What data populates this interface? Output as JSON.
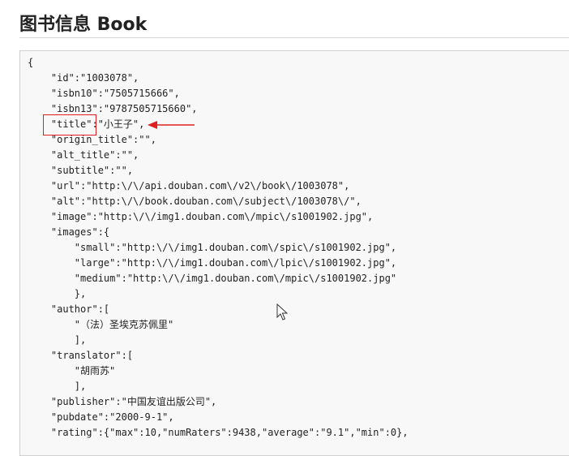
{
  "page": {
    "title": "图书信息 Book"
  },
  "code": {
    "lines": [
      "{",
      "    \"id\":\"1003078\",",
      "    \"isbn10\":\"7505715666\",",
      "    \"isbn13\":\"9787505715660\",",
      "    \"title\":\"小王子\",",
      "    \"origin_title\":\"\",",
      "    \"alt_title\":\"\",",
      "    \"subtitle\":\"\",",
      "    \"url\":\"http:\\/\\/api.douban.com\\/v2\\/book\\/1003078\",",
      "    \"alt\":\"http:\\/\\/book.douban.com\\/subject\\/1003078\\/\",",
      "    \"image\":\"http:\\/\\/img1.douban.com\\/mpic\\/s1001902.jpg\",",
      "    \"images\":{",
      "        \"small\":\"http:\\/\\/img1.douban.com\\/spic\\/s1001902.jpg\",",
      "        \"large\":\"http:\\/\\/img1.douban.com\\/lpic\\/s1001902.jpg\",",
      "        \"medium\":\"http:\\/\\/img1.douban.com\\/mpic\\/s1001902.jpg\"",
      "        },",
      "    \"author\":[",
      "        \"（法）圣埃克苏佩里\"",
      "        ],",
      "    \"translator\":[",
      "        \"胡雨苏\"",
      "        ],",
      "    \"publisher\":\"中国友谊出版公司\",",
      "    \"pubdate\":\"2000-9-1\",",
      "    \"rating\":{\"max\":10,\"numRaters\":9438,\"average\":\"9.1\",\"min\":0},"
    ]
  },
  "annotation": {
    "highlight_color": "#e02020"
  }
}
